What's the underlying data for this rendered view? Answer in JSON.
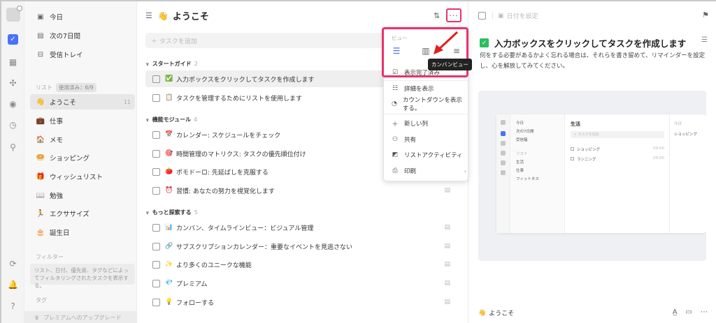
{
  "rail": {
    "icons": [
      "avatar",
      "check-square-icon",
      "calendar-icon",
      "grid-icon",
      "target-icon",
      "clock-icon",
      "search-icon",
      "sync-icon",
      "bell-icon",
      "help-icon"
    ]
  },
  "sidebar": {
    "top_items": [
      {
        "label": "今日",
        "icon": "calendar-today-icon"
      },
      {
        "label": "次の7日間",
        "icon": "calendar-week-icon"
      },
      {
        "label": "受信トレイ",
        "icon": "inbox-icon"
      }
    ],
    "lists_section_label": "リスト",
    "lists_usage_badge": "使用済み：6/9",
    "lists": [
      {
        "label": "ようこそ",
        "emoji": "👋",
        "count": "11"
      },
      {
        "label": "仕事",
        "emoji": "💼",
        "count": ""
      },
      {
        "label": "メモ",
        "emoji": "🏠",
        "count": ""
      },
      {
        "label": "ショッピング",
        "emoji": "🥯",
        "count": ""
      },
      {
        "label": "ウィッシュリスト",
        "emoji": "🎁",
        "count": ""
      },
      {
        "label": "勉強",
        "emoji": "📖",
        "count": ""
      },
      {
        "label": "エクササイズ",
        "emoji": "🏃",
        "count": ""
      },
      {
        "label": "誕生日",
        "emoji": "🎂",
        "count": ""
      }
    ],
    "filters_section_label": "フィルター",
    "filters_hint": "リスト、日付、優先度、タグなどによってフィルタリングされたタスクを表示する。",
    "tags_section_label": "タグ",
    "upgrade_label": "プレミアムへのアップグレード"
  },
  "main": {
    "title": "ようこそ",
    "title_emoji": "👋",
    "add_task_placeholder": "＋ タスクを追加",
    "groups": [
      {
        "name": "スタートガイド",
        "count": "2",
        "tasks": [
          {
            "label": "入力ボックスをクリックしてタスクを作成します",
            "emoji": "✅",
            "selected": true
          },
          {
            "label": "タスクを管理するためにリストを使用します",
            "emoji": "📋",
            "selected": false
          }
        ]
      },
      {
        "name": "機能モジュール",
        "count": "4",
        "tasks": [
          {
            "label": "カレンダー: スケジュールをチェック",
            "emoji": "📅",
            "selected": false
          },
          {
            "label": "時間管理のマトリクス: タスクの優先順位付け",
            "emoji": "🎯",
            "selected": false
          },
          {
            "label": "ポモドーロ: 先延ばしを克服する",
            "emoji": "🍅",
            "selected": false
          },
          {
            "label": "習慣: あなたの努力を視覚化します",
            "emoji": "⏰",
            "selected": false
          }
        ]
      },
      {
        "name": "もっと探索する",
        "count": "5",
        "tasks": [
          {
            "label": "カンバン、タイムラインビュー：ビジュアル管理",
            "emoji": "📊",
            "selected": false
          },
          {
            "label": "サブスクリプションカレンダー：重要なイベントを見逃さない",
            "emoji": "🔗",
            "selected": false
          },
          {
            "label": "より多くのユニークな機能",
            "emoji": "✨",
            "selected": false
          },
          {
            "label": "プレミアム",
            "emoji": "💎",
            "selected": false
          },
          {
            "label": "フォローする",
            "emoji": "💡",
            "selected": false
          }
        ]
      }
    ]
  },
  "menu": {
    "view_label": "ビュー",
    "tooltip": "カンバンビュー",
    "items": [
      {
        "label": "表示完了済み",
        "icon": "check-square-icon"
      },
      {
        "label": "詳細を表示",
        "icon": "details-icon"
      },
      {
        "label": "カウントダウンを表示する。",
        "icon": "countdown-icon"
      },
      {
        "label": "新しい列",
        "icon": "plus-icon"
      },
      {
        "label": "共有",
        "icon": "share-icon"
      },
      {
        "label": "リストアクティビティ",
        "icon": "activity-icon"
      },
      {
        "label": "印刷",
        "icon": "print-icon"
      }
    ]
  },
  "detail": {
    "date_placeholder": "日付を設定",
    "title": "入力ボックスをクリックしてタスクを作成します",
    "description": "何をする必要があるかよく忘れる場合は、それらを書き留めて、リマインダーを設定し、心を解放してみてください。",
    "footer_list": "ようこそ",
    "preview": {
      "sidebar_items": [
        "今日",
        "次の7日間",
        "受信箱",
        "リスト",
        "生活",
        "仕事",
        "フィットネス"
      ],
      "header": "生活",
      "add_placeholder": "＋ タスクを追加",
      "tasks": [
        {
          "label": "ショッピング",
          "time": "09:00"
        },
        {
          "label": "ランニング",
          "time": "09:00"
        }
      ],
      "right_date": "今日",
      "right_task": "ショッピング"
    }
  },
  "colors": {
    "accent": "#4772fa",
    "highlight": "#e8336a",
    "check_green": "#2cbf5f"
  }
}
